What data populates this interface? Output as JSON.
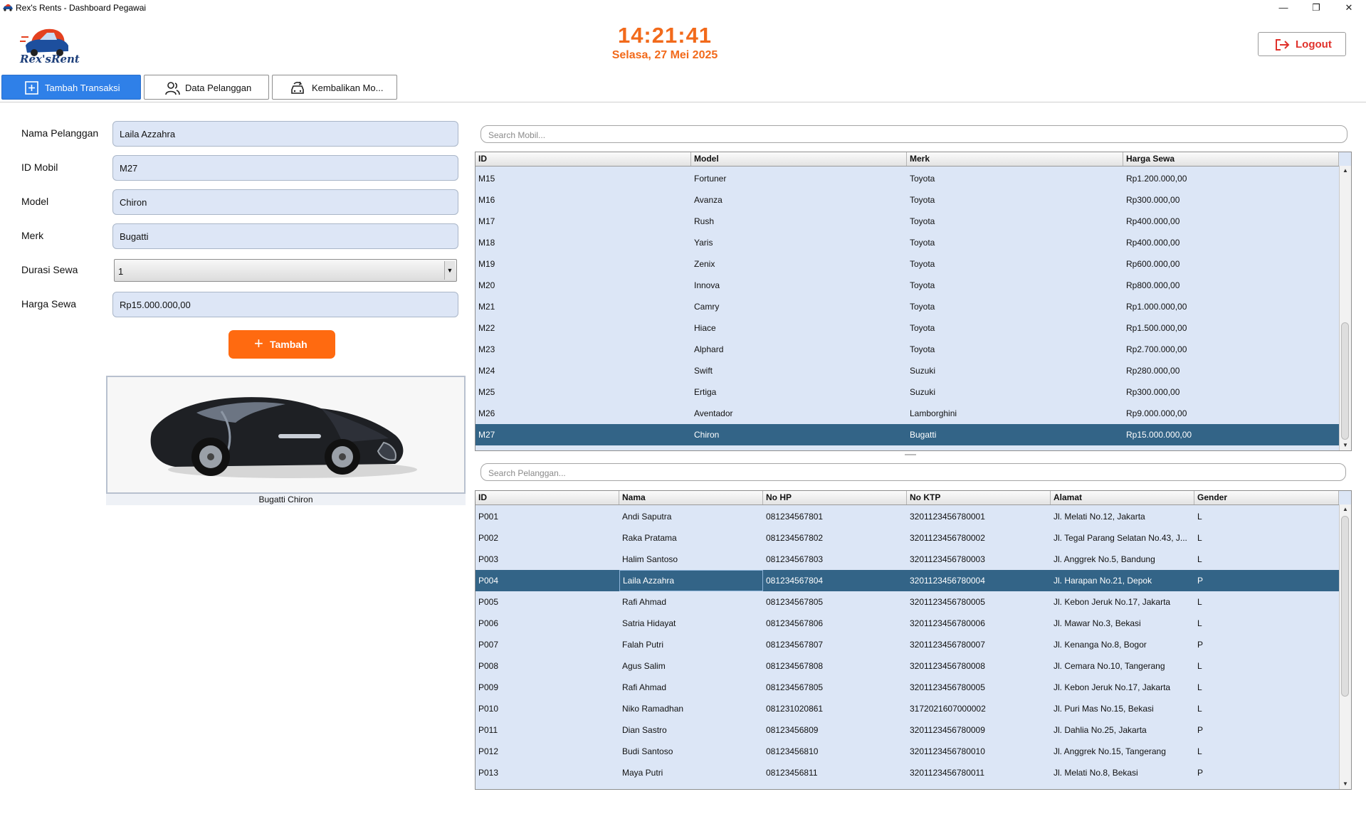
{
  "window": {
    "title": "Rex's Rents - Dashboard Pegawai",
    "minimize_label": "—",
    "maximize_label": "❐",
    "close_label": "✕"
  },
  "header": {
    "logo_text": "Rex'sRent",
    "time": "14:21:41",
    "date": "Selasa, 27 Mei 2025",
    "logout_label": "Logout"
  },
  "tabs": [
    {
      "label": "Tambah Transaksi",
      "icon": "plus-square-icon"
    },
    {
      "label": "Data Pelanggan",
      "icon": "users-icon"
    },
    {
      "label": "Kembalikan Mo...",
      "icon": "car-return-icon"
    }
  ],
  "form": {
    "nama_pelanggan": {
      "label": "Nama Pelanggan",
      "value": "Laila Azzahra"
    },
    "id_mobil": {
      "label": "ID Mobil",
      "value": "M27"
    },
    "model": {
      "label": "Model",
      "value": "Chiron"
    },
    "merk": {
      "label": "Merk",
      "value": "Bugatti"
    },
    "durasi_sewa": {
      "label": "Durasi Sewa",
      "value": "1"
    },
    "harga_sewa": {
      "label": "Harga Sewa",
      "value": "Rp15.000.000,00"
    },
    "add_button_label": "Tambah",
    "preview_caption": "Bugatti Chiron"
  },
  "cars_table": {
    "search_placeholder": "Search Mobil...",
    "columns": [
      "ID",
      "Model",
      "Merk",
      "Harga Sewa"
    ],
    "rows": [
      [
        "M15",
        "Fortuner",
        "Toyota",
        "Rp1.200.000,00"
      ],
      [
        "M16",
        "Avanza",
        "Toyota",
        "Rp300.000,00"
      ],
      [
        "M17",
        "Rush",
        "Toyota",
        "Rp400.000,00"
      ],
      [
        "M18",
        "Yaris",
        "Toyota",
        "Rp400.000,00"
      ],
      [
        "M19",
        "Zenix",
        "Toyota",
        "Rp600.000,00"
      ],
      [
        "M20",
        "Innova",
        "Toyota",
        "Rp800.000,00"
      ],
      [
        "M21",
        "Camry",
        "Toyota",
        "Rp1.000.000,00"
      ],
      [
        "M22",
        "Hiace",
        "Toyota",
        "Rp1.500.000,00"
      ],
      [
        "M23",
        "Alphard",
        "Toyota",
        "Rp2.700.000,00"
      ],
      [
        "M24",
        "Swift",
        "Suzuki",
        "Rp280.000,00"
      ],
      [
        "M25",
        "Ertiga",
        "Suzuki",
        "Rp300.000,00"
      ],
      [
        "M26",
        "Aventador",
        "Lamborghini",
        "Rp9.000.000,00"
      ],
      [
        "M27",
        "Chiron",
        "Bugatti",
        "Rp15.000.000,00"
      ]
    ],
    "selected_index": 12
  },
  "customers_table": {
    "search_placeholder": "Search Pelanggan...",
    "columns": [
      "ID",
      "Nama",
      "No HP",
      "No KTP",
      "Alamat",
      "Gender"
    ],
    "rows": [
      [
        "P001",
        "Andi Saputra",
        "081234567801",
        "3201123456780001",
        "Jl. Melati No.12, Jakarta",
        "L"
      ],
      [
        "P002",
        "Raka Pratama",
        "081234567802",
        "3201123456780002",
        "Jl. Tegal Parang Selatan No.43, J...",
        "L"
      ],
      [
        "P003",
        "Halim Santoso",
        "081234567803",
        "3201123456780003",
        "Jl. Anggrek No.5, Bandung",
        "L"
      ],
      [
        "P004",
        "Laila Azzahra",
        "081234567804",
        "3201123456780004",
        "Jl. Harapan No.21, Depok",
        "P"
      ],
      [
        "P005",
        "Rafi Ahmad",
        "081234567805",
        "3201123456780005",
        "Jl. Kebon Jeruk No.17, Jakarta",
        "L"
      ],
      [
        "P006",
        "Satria Hidayat",
        "081234567806",
        "3201123456780006",
        "Jl. Mawar No.3, Bekasi",
        "L"
      ],
      [
        "P007",
        "Falah Putri",
        "081234567807",
        "3201123456780007",
        "Jl. Kenanga No.8, Bogor",
        "P"
      ],
      [
        "P008",
        "Agus Salim",
        "081234567808",
        "3201123456780008",
        "Jl. Cemara No.10, Tangerang",
        "L"
      ],
      [
        "P009",
        "Rafi Ahmad",
        "081234567805",
        "3201123456780005",
        "Jl. Kebon Jeruk No.17, Jakarta",
        "L"
      ],
      [
        "P010",
        "Niko Ramadhan",
        "081231020861",
        "3172021607000002",
        "Jl. Puri Mas No.15, Bekasi",
        "L"
      ],
      [
        "P011",
        "Dian Sastro",
        "08123456809",
        "3201123456780009",
        "Jl. Dahlia No.25, Jakarta",
        "P"
      ],
      [
        "P012",
        "Budi Santoso",
        "08123456810",
        "3201123456780010",
        "Jl. Anggrek No.15, Tangerang",
        "L"
      ],
      [
        "P013",
        "Maya Putri",
        "08123456811",
        "3201123456780011",
        "Jl. Melati No.8, Bekasi",
        "P"
      ]
    ],
    "selected_index": 3
  },
  "colors": {
    "accent_orange": "#ff6a10",
    "tab_active": "#2f80e8",
    "row_selected": "#336487",
    "logout_red": "#e0312b"
  }
}
